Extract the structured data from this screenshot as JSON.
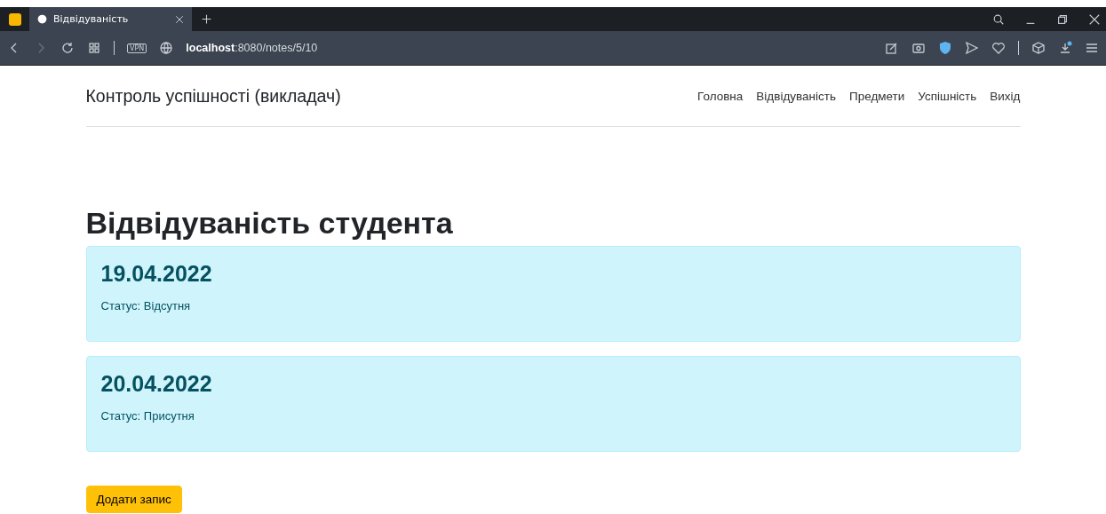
{
  "browser": {
    "tab": {
      "title": "Відвідуваність"
    },
    "address": {
      "host": "localhost",
      "path": ":8080/notes/5/10"
    },
    "vpn": "VPN"
  },
  "navbar": {
    "brand": "Контроль успішності (викладач)",
    "links": [
      "Головна",
      "Відвідуваність",
      "Предмети",
      "Успішність",
      "Вихід"
    ]
  },
  "heading": "Відвідуваність студента",
  "records": [
    {
      "date": "19.04.2022",
      "status": "Статус: Відсутня"
    },
    {
      "date": "20.04.2022",
      "status": "Статус: Присутня"
    }
  ],
  "add_button": "Додати запис"
}
